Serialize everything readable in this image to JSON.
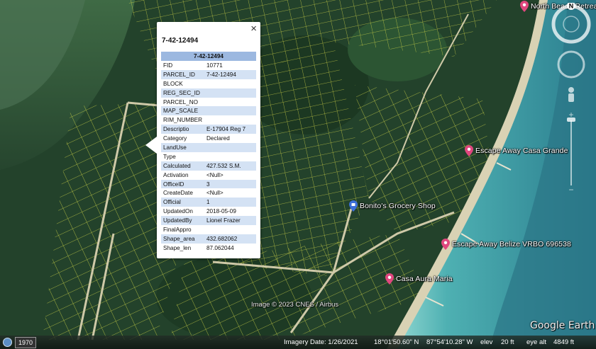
{
  "balloon": {
    "title": "7-42-12494",
    "table_header": "7-42-12494",
    "rows": [
      {
        "key": "FID",
        "value": "10771"
      },
      {
        "key": "PARCEL_ID",
        "value": "7-42-12494"
      },
      {
        "key": "BLOCK",
        "value": ""
      },
      {
        "key": "REG_SEC_ID",
        "value": ""
      },
      {
        "key": "PARCEL_NO",
        "value": ""
      },
      {
        "key": "MAP_SCALE",
        "value": ""
      },
      {
        "key": "RIM_NUMBER",
        "value": ""
      },
      {
        "key": "Descriptio",
        "value": "E-17904 Reg 7"
      },
      {
        "key": "Category",
        "value": "Declared"
      },
      {
        "key": "LandUse",
        "value": ""
      },
      {
        "key": "Type",
        "value": ""
      },
      {
        "key": "Calculated",
        "value": "427.532 S.M."
      },
      {
        "key": "Activation",
        "value": "<Null>"
      },
      {
        "key": "OfficeID",
        "value": "3"
      },
      {
        "key": "CreateDate",
        "value": "<Null>"
      },
      {
        "key": "Official",
        "value": "1"
      },
      {
        "key": "UpdatedOn",
        "value": "2018-05-09"
      },
      {
        "key": "UpdatedBy",
        "value": "Lionel Frazer"
      },
      {
        "key": "FinalAppro",
        "value": ""
      },
      {
        "key": "Shape_area",
        "value": "432.682062"
      },
      {
        "key": "Shape_len",
        "value": "87.062044"
      }
    ],
    "close_icon": "×"
  },
  "places": {
    "north_beach": "North Beach Retreat",
    "escape_casa_grande": "Escape Away Casa Grande",
    "bonitos": "Bonito's Grocery Shop",
    "escape_belize": "Escape Away Belize VRBO 696538",
    "casa_aura": "Casa Aura Maria"
  },
  "nav": {
    "north_label": "N"
  },
  "overlay": {
    "copyright": "Image © 2023 CNES / Airbus",
    "brand": "Google Earth"
  },
  "status": {
    "historical_year": "1970",
    "imagery_date": "Imagery Date: 1/26/2021",
    "lat": "18°01'50.60\" N",
    "lon": "87°54'10.28\" W",
    "elev_label": "elev",
    "elev_value": "20 ft",
    "eye_label": "eye alt",
    "eye_value": "4849 ft"
  },
  "colors": {
    "parcel_line": "#e3e64a",
    "water_deep": "#2f7f8a",
    "water_shallow": "#5ab3b0",
    "pin_pink": "#e0477e",
    "pin_blue": "#3c6fd8",
    "table_header": "#9cb8e0",
    "table_alt": "#d4e2f4"
  }
}
